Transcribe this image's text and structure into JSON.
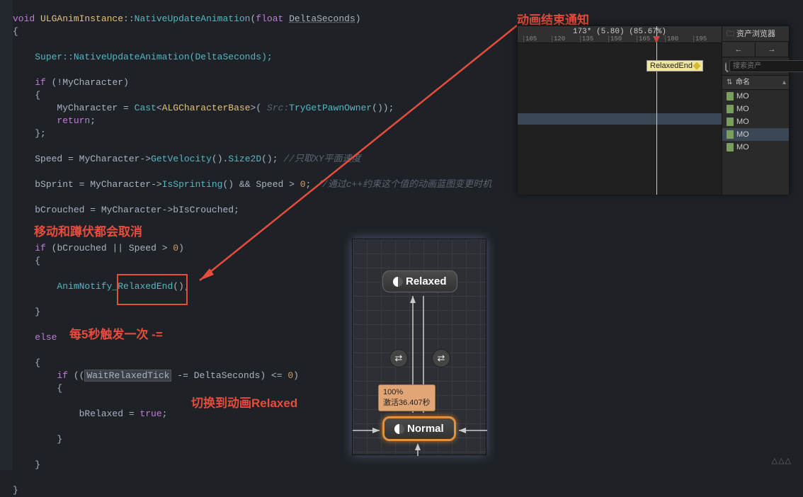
{
  "annotations": {
    "top": "动画结束通知",
    "cancel": "移动和蹲伏都会取消",
    "trigger": "每5秒触发一次 -=",
    "switch": "切换到动画Relaxed"
  },
  "code": {
    "func_sig_pre": "void ",
    "cls": "ULGAnimInstance",
    "method": "NativeUpdateAnimation",
    "param_type": "float",
    "param": "DeltaSeconds",
    "super_call": "Super::NativeUpdateAnimation(DeltaSeconds);",
    "mychar": "MyCharacter",
    "cast": "Cast",
    "charbase": "ALGCharacterBase",
    "src": "Src:",
    "trygetpawn": "TryGetPawnOwner",
    "return": "return",
    "speed": "Speed",
    "getvel": "GetVelocity",
    "size2d": "Size2D",
    "comment_speed": "//只取XY平面速度",
    "bsprint": "bSprint",
    "issprinting": "IsSprinting",
    "comment_sprint": "//通过c++约束这个值的动画蓝图变更时机",
    "bcrouched": "bCrouched",
    "biscrouched": "bIsCrouched",
    "animnotify": "AnimNotify_RelaxedEnd",
    "waitrelaxed": "WaitRelaxedTick",
    "brelaxed": "bRelaxed",
    "true": "true",
    "zero": "0"
  },
  "timeline": {
    "info": "173* (5.80) (85.67%)",
    "ticks": [
      "105",
      "120",
      "135",
      "150",
      "165",
      "180",
      "195"
    ],
    "notify": "RelaxedEnd",
    "asset_browser": "资产浏览器",
    "search_placeholder": "搜索资产",
    "col_name": "命名",
    "nav_back": "←",
    "nav_fwd": "→",
    "assets": [
      "MO",
      "MO",
      "MO",
      "MO",
      "MO"
    ],
    "selected_index": 3
  },
  "state_machine": {
    "relaxed": "Relaxed",
    "normal": "Normal",
    "tooltip_pct": "100%",
    "tooltip_time": "激活36.407秒",
    "trans_sym": "⇄"
  },
  "hidden_chars": "△△△"
}
